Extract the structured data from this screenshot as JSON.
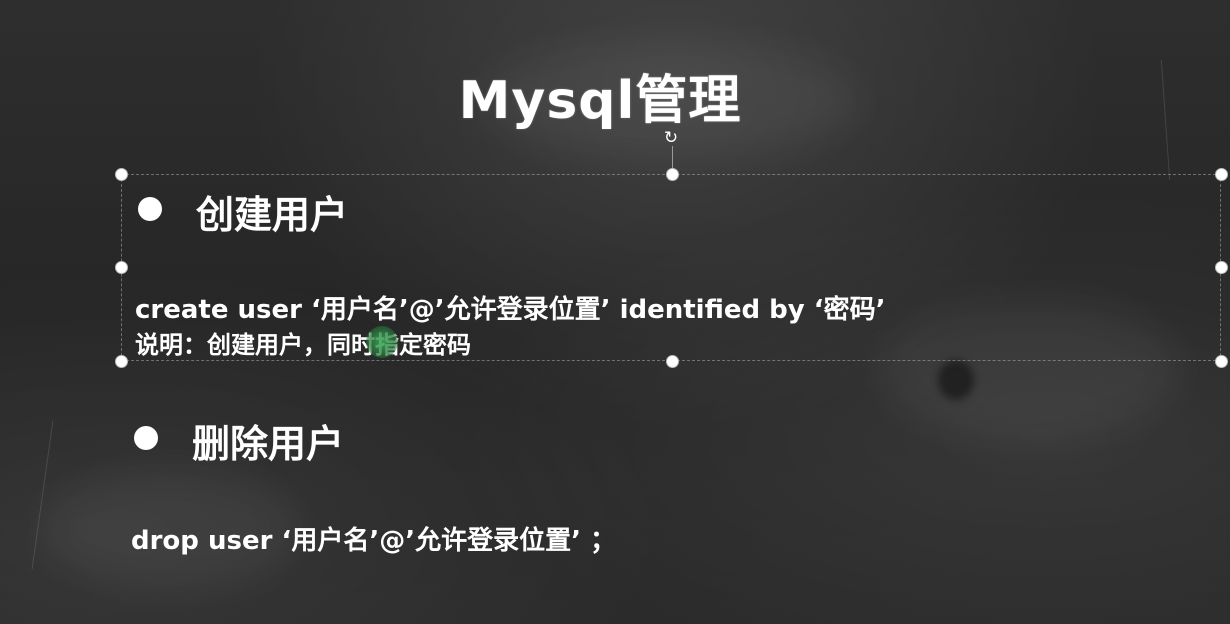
{
  "slide": {
    "title": "Mysql管理",
    "section_create": {
      "heading": "创建用户",
      "command": "create  user   ‘用户名’@’允许登录位置’   identified  by   ‘密码’",
      "note": "说明：创建用户，同时指定密码"
    },
    "section_drop": {
      "heading": "删除用户",
      "command": "drop  user   ‘用户名’@’允许登录位置’ ；"
    }
  },
  "icons": {
    "rotate": "rotate-handle-icon",
    "bullet": "bullet-dot"
  },
  "colors": {
    "background": "#2a2a2a",
    "text": "#ffffff",
    "cursor_highlight": "#3aa85a"
  }
}
